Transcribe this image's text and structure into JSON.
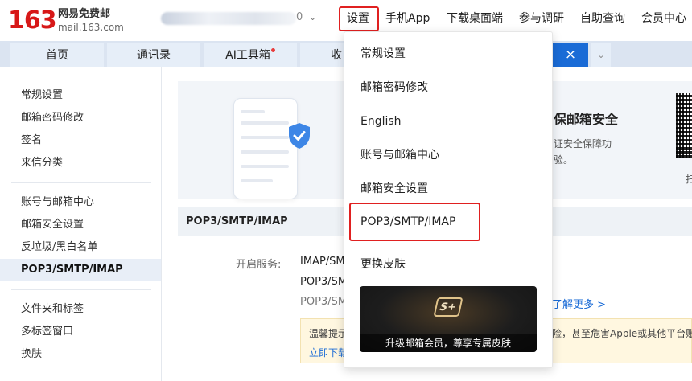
{
  "header": {
    "logo_number": "163",
    "logo_name": "网易免费邮",
    "logo_url": "mail.163.com",
    "user_tail": "0",
    "nav": [
      "设置",
      "手机App",
      "下载桌面端",
      "参与调研",
      "自助查询",
      "会员中心"
    ]
  },
  "tabs": [
    {
      "label": "首页"
    },
    {
      "label": "通讯录"
    },
    {
      "label": "AI工具箱"
    },
    {
      "label": "收"
    }
  ],
  "tab_close": "×",
  "sidebar": {
    "group1": [
      "常规设置",
      "邮箱密码修改",
      "签名",
      "来信分类"
    ],
    "group2": [
      "账号与邮箱中心",
      "邮箱安全设置",
      "反垃圾/黑白名单",
      "POP3/SMTP/IMAP"
    ],
    "group3": [
      "文件夹和标签",
      "多标签窗口",
      "换肤"
    ],
    "active": "POP3/SMTP/IMAP"
  },
  "banner": {
    "title": "保邮箱安全",
    "sub1": "证安全保障功",
    "sub2": "验。",
    "qr_caption": "扫"
  },
  "section": {
    "title": "POP3/SMTP/IMAP",
    "service_label": "开启服务:",
    "services": [
      "IMAP/SM",
      "POP3/SM",
      "POP3/SM"
    ],
    "learn_more": "了解更多 >",
    "tip_left": "温馨提示",
    "tip_right": "险，甚至危害Apple或其他平台账",
    "tip_link": "立即下载"
  },
  "menu": {
    "items": [
      "常规设置",
      "邮箱密码修改",
      "English",
      "账号与邮箱中心",
      "邮箱安全设置",
      "POP3/SMTP/IMAP",
      "更换皮肤"
    ],
    "skin_logo": "S+",
    "skin_caption": "升级邮箱会员，尊享专属皮肤"
  },
  "colors": {
    "accent": "#1a6bd6",
    "brand_red": "#d71818",
    "highlight_red": "#e02020"
  }
}
